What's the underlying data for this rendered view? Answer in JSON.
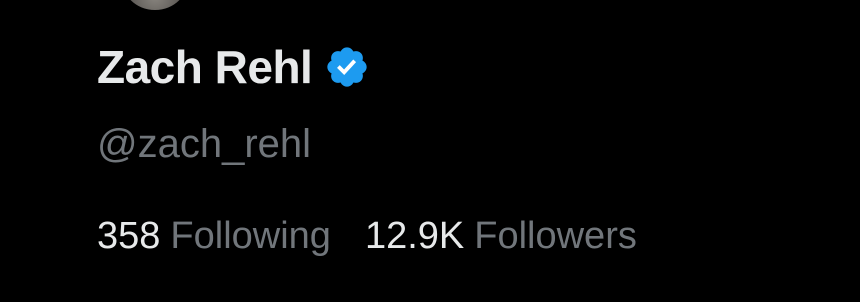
{
  "profile": {
    "display_name": "Zach Rehl",
    "handle": "@zach_rehl",
    "verified": true,
    "verified_icon": "verified-badge-icon",
    "avatar_icon": "avatar"
  },
  "stats": {
    "following_count": "358",
    "following_label": "Following",
    "followers_count": "12.9K",
    "followers_label": "Followers"
  },
  "colors": {
    "background": "#000000",
    "primary_text": "#e7e9ea",
    "secondary_text": "#71767b",
    "verified_blue": "#1d9bf0"
  }
}
